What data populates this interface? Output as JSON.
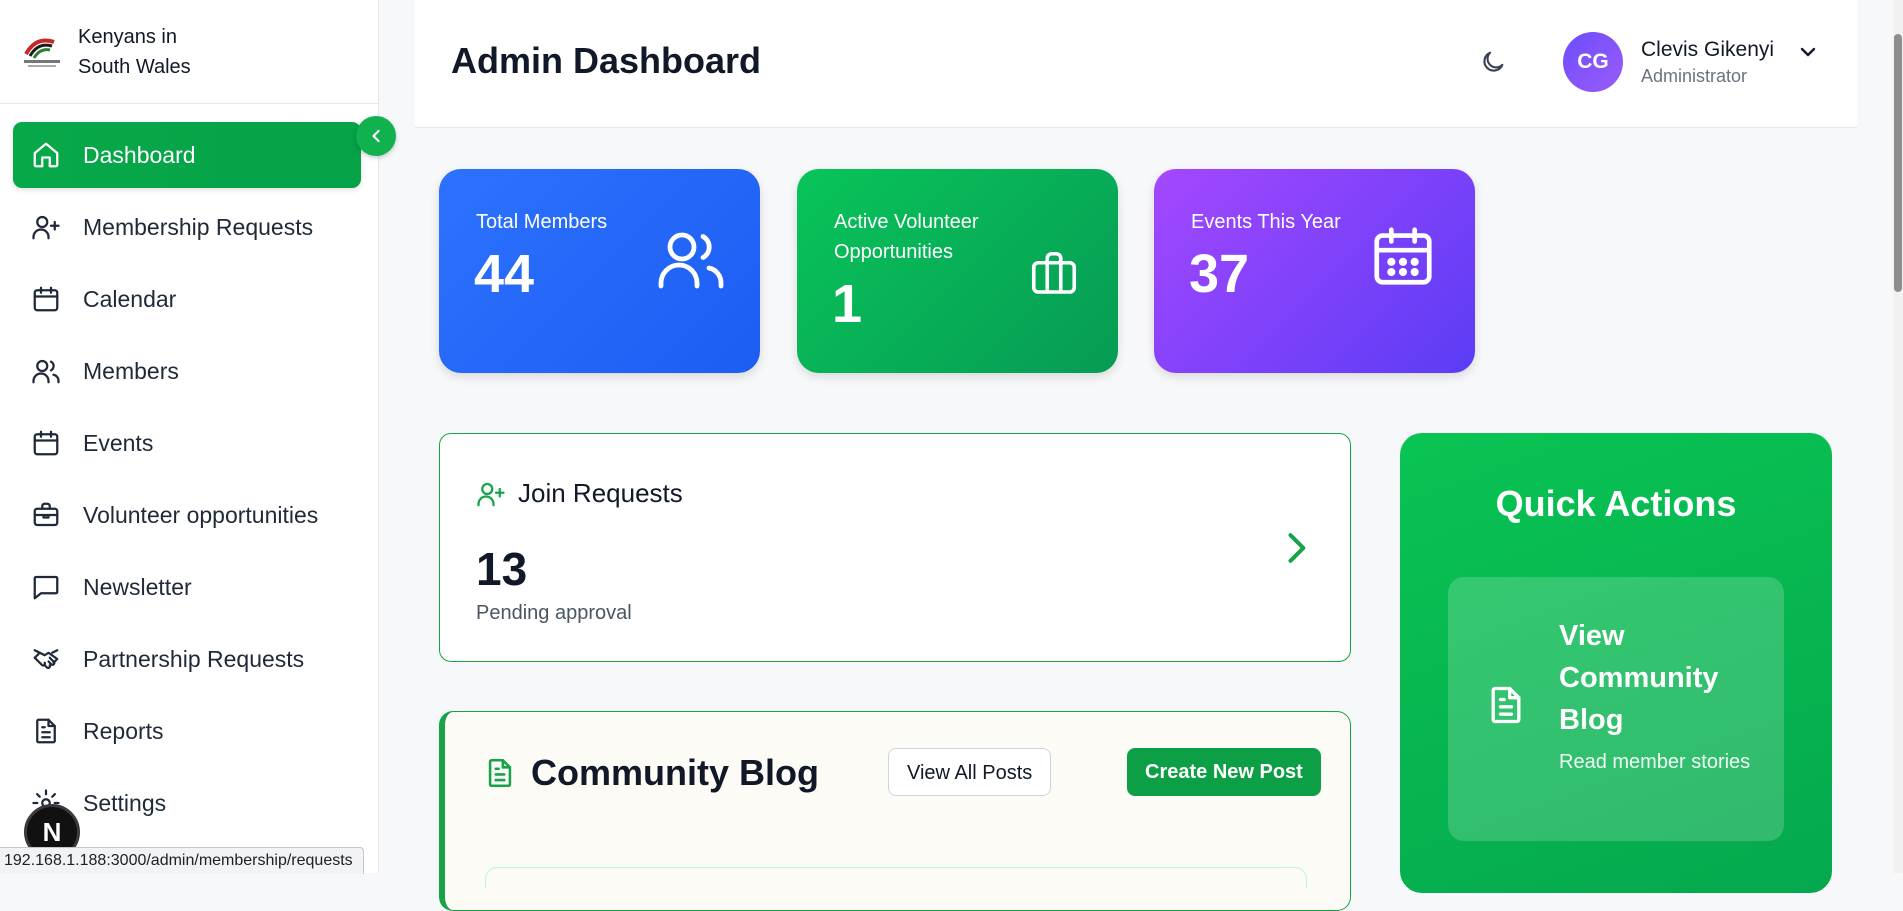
{
  "brand": {
    "name_line1": "Kenyans in",
    "name_line2": "South Wales",
    "logo_text": "Kenyans in South Wales"
  },
  "sidebar": {
    "items": [
      {
        "label": "Dashboard",
        "icon": "home-icon",
        "active": true
      },
      {
        "label": "Membership Requests",
        "icon": "user-plus-icon"
      },
      {
        "label": "Calendar",
        "icon": "calendar-icon"
      },
      {
        "label": "Members",
        "icon": "users-icon"
      },
      {
        "label": "Events",
        "icon": "calendar-icon"
      },
      {
        "label": "Volunteer opportunities",
        "icon": "briefcase-icon"
      },
      {
        "label": "Newsletter",
        "icon": "message-square-icon"
      },
      {
        "label": "Partnership Requests",
        "icon": "handshake-icon"
      },
      {
        "label": "Reports",
        "icon": "file-text-icon"
      },
      {
        "label": "Settings",
        "icon": "gear-icon"
      }
    ]
  },
  "header": {
    "title": "Admin Dashboard",
    "user": {
      "initials": "CG",
      "name": "Clevis Gikenyi",
      "role": "Administrator"
    }
  },
  "stats": {
    "members": {
      "label": "Total Members",
      "value": "44"
    },
    "volunteer": {
      "label": "Active Volunteer Opportunities",
      "value": "1"
    },
    "events": {
      "label": "Events This Year",
      "value": "37"
    }
  },
  "join_requests": {
    "title": "Join Requests",
    "count": "13",
    "subtitle": "Pending approval"
  },
  "blog": {
    "title": "Community Blog",
    "view_all": "View All Posts",
    "create": "Create New Post"
  },
  "quick_actions": {
    "title": "Quick Actions",
    "items": [
      {
        "title": "View Community Blog",
        "subtitle": "Read member stories"
      }
    ]
  },
  "dev_badge": "N",
  "status_url": "192.168.1.188:3000/admin/membership/requests",
  "colors": {
    "primary_green": "#07a84a",
    "blue": "#2d72ff",
    "purple": "#a448ff",
    "avatar": "#6d4cff"
  }
}
